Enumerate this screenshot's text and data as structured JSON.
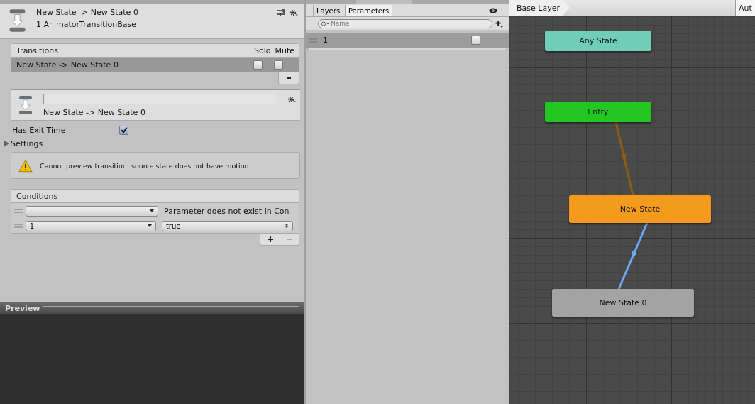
{
  "inspector": {
    "title": "New State -> New State 0",
    "subtitle": "1 AnimatorTransitionBase",
    "transitions": {
      "header": "Transitions",
      "solo_label": "Solo",
      "mute_label": "Mute",
      "rows": [
        {
          "name": "New State -> New State 0",
          "selected": true,
          "solo": false,
          "mute": false
        }
      ]
    },
    "detail": {
      "caption": "New State -> New State 0"
    },
    "has_exit_time": {
      "label": "Has Exit Time",
      "checked": true
    },
    "settings": {
      "label": "Settings",
      "expanded": false
    },
    "warning": "Cannot preview transition: source state does not have motion",
    "conditions": {
      "header": "Conditions",
      "rows": [
        {
          "kind": "missing",
          "note": "Parameter does not exist in Con"
        },
        {
          "kind": "bool",
          "parameter": "1",
          "value": "true"
        }
      ]
    }
  },
  "preview": {
    "title": "Preview"
  },
  "parameters": {
    "tabs": [
      {
        "label": "Layers",
        "selected": false
      },
      {
        "label": "Parameters",
        "selected": true
      }
    ],
    "search": {
      "placeholder": "Name"
    },
    "items": [
      {
        "name": "1",
        "checked": false
      }
    ]
  },
  "graph": {
    "breadcrumb": "Base Layer",
    "corner_tab": "Aut",
    "nodes": [
      {
        "name": "Any State",
        "color": "#6fcdb9"
      },
      {
        "name": "Entry",
        "color": "#22c722"
      },
      {
        "name": "New State",
        "color": "#f49a1c"
      },
      {
        "name": "New State 0",
        "color": "#a3a3a3"
      }
    ],
    "transitions": [
      {
        "color": "#8a5e10"
      },
      {
        "color": "#6aaaf5"
      }
    ]
  }
}
